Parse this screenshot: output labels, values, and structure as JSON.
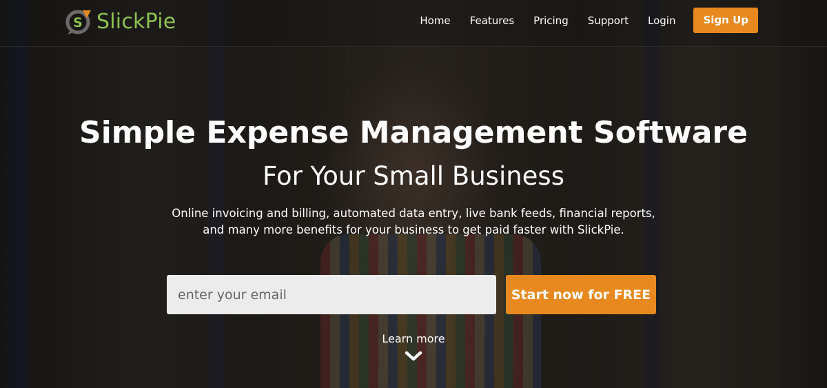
{
  "brand": {
    "name": "SlickPie",
    "logo_glyph": "S",
    "colors": {
      "green": "#8cc152",
      "orange": "#e8891f",
      "gray": "#5a5a5a"
    }
  },
  "nav": {
    "items": [
      {
        "label": "Home"
      },
      {
        "label": "Features"
      },
      {
        "label": "Pricing"
      },
      {
        "label": "Support"
      },
      {
        "label": "Login"
      }
    ],
    "signup_label": "Sign Up"
  },
  "hero": {
    "headline": "Simple Expense Management Software",
    "subheadline": "For Your Small Business",
    "description_line1": "Online invoicing and billing, automated data entry, live bank feeds, financial reports,",
    "description_line2": "and many more benefits for your business to get paid faster with SlickPie."
  },
  "signup_form": {
    "email_placeholder": "enter your email",
    "cta_label": "Start now for FREE"
  },
  "learn_more": {
    "label": "Learn more",
    "icon": "chevron-down-icon"
  }
}
